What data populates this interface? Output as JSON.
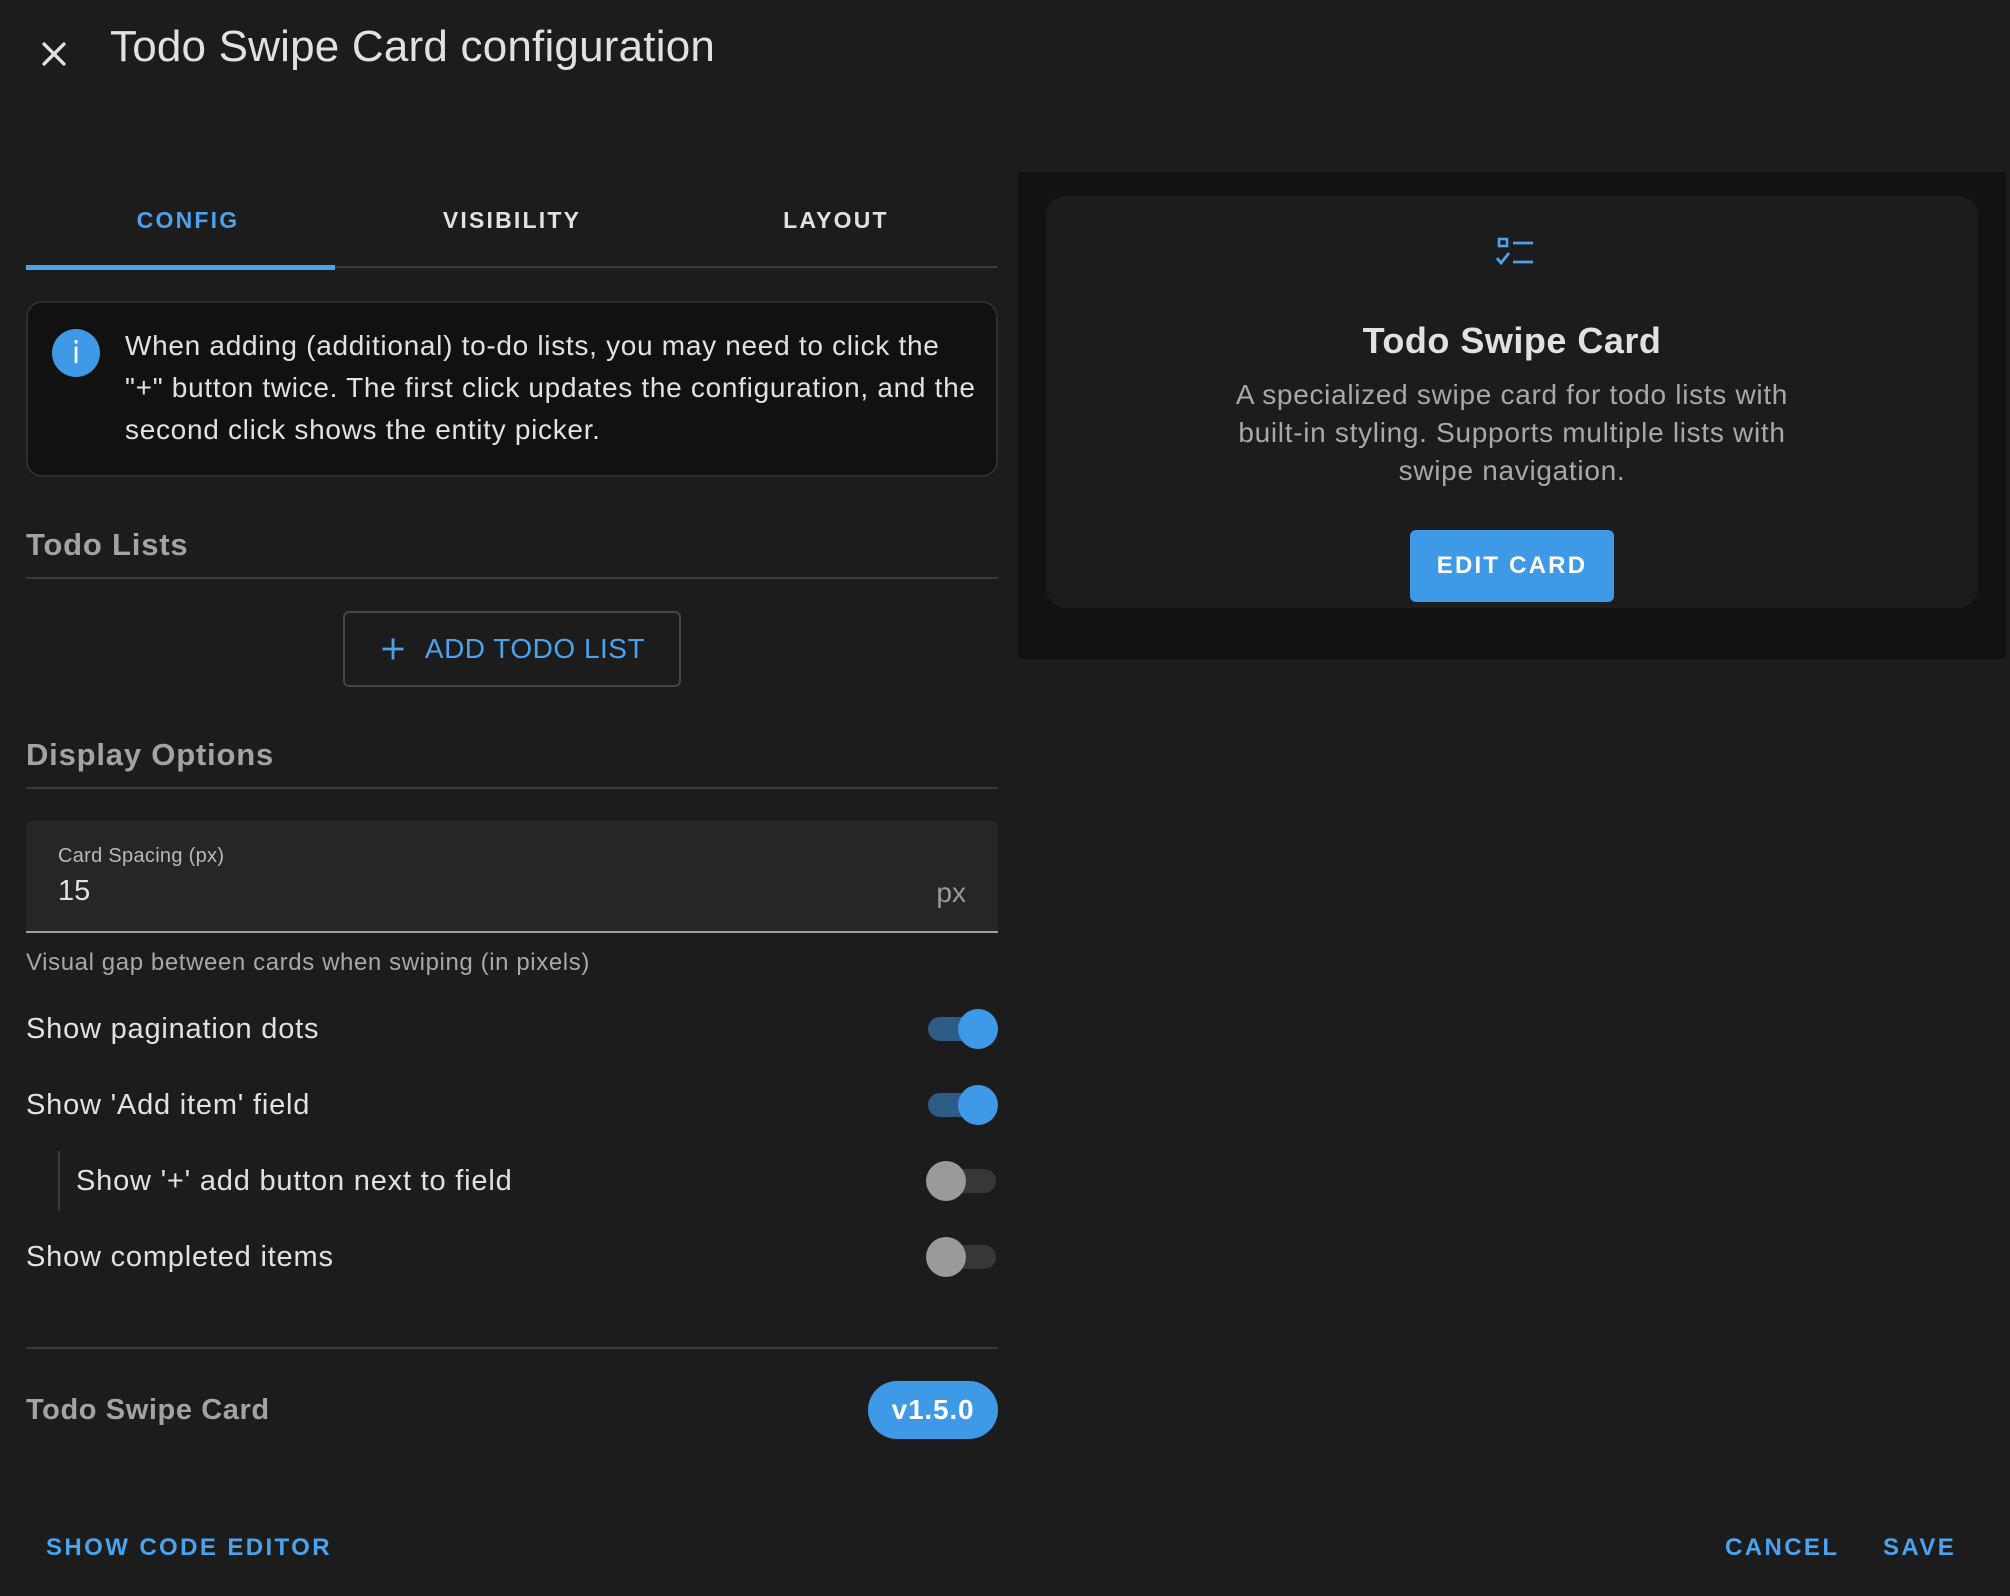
{
  "dialog": {
    "title": "Todo Swipe Card configuration",
    "close_icon": "close-icon"
  },
  "tabs": [
    {
      "label": "CONFIG",
      "active": true
    },
    {
      "label": "VISIBILITY",
      "active": false
    },
    {
      "label": "LAYOUT",
      "active": false
    }
  ],
  "info": {
    "icon": "info-icon",
    "icon_glyph": "i",
    "text": "When adding (additional) to-do lists, you may need to click the \"+\" button twice. The first click updates the configuration, and the second click shows the entity picker."
  },
  "todo_lists": {
    "title": "Todo Lists",
    "add_button": {
      "icon": "plus-icon",
      "label": "ADD TODO LIST"
    }
  },
  "display_options": {
    "title": "Display Options",
    "card_spacing": {
      "label": "Card Spacing (px)",
      "value": "15",
      "suffix": "px",
      "helper": "Visual gap between cards when swiping (in pixels)"
    },
    "toggles": [
      {
        "label": "Show pagination dots",
        "on": true,
        "indented": false
      },
      {
        "label": "Show 'Add item' field",
        "on": true,
        "indented": false
      },
      {
        "label": "Show '+' add button next to field",
        "on": false,
        "indented": true
      },
      {
        "label": "Show completed items",
        "on": false,
        "indented": false
      }
    ]
  },
  "footer": {
    "name": "Todo Swipe Card",
    "version": "v1.5.0"
  },
  "preview": {
    "icon": "checklist-icon",
    "title": "Todo Swipe Card",
    "description": "A specialized swipe card for todo lists with built-in styling. Supports multiple lists with swipe navigation.",
    "edit_button": "EDIT CARD"
  },
  "actions": {
    "show_code_editor": "SHOW CODE EDITOR",
    "cancel": "CANCEL",
    "save": "SAVE"
  },
  "colors": {
    "accent": "#3e99e6",
    "background": "#1c1c1c",
    "info_background": "#111111",
    "text": "#e1e1e1"
  }
}
